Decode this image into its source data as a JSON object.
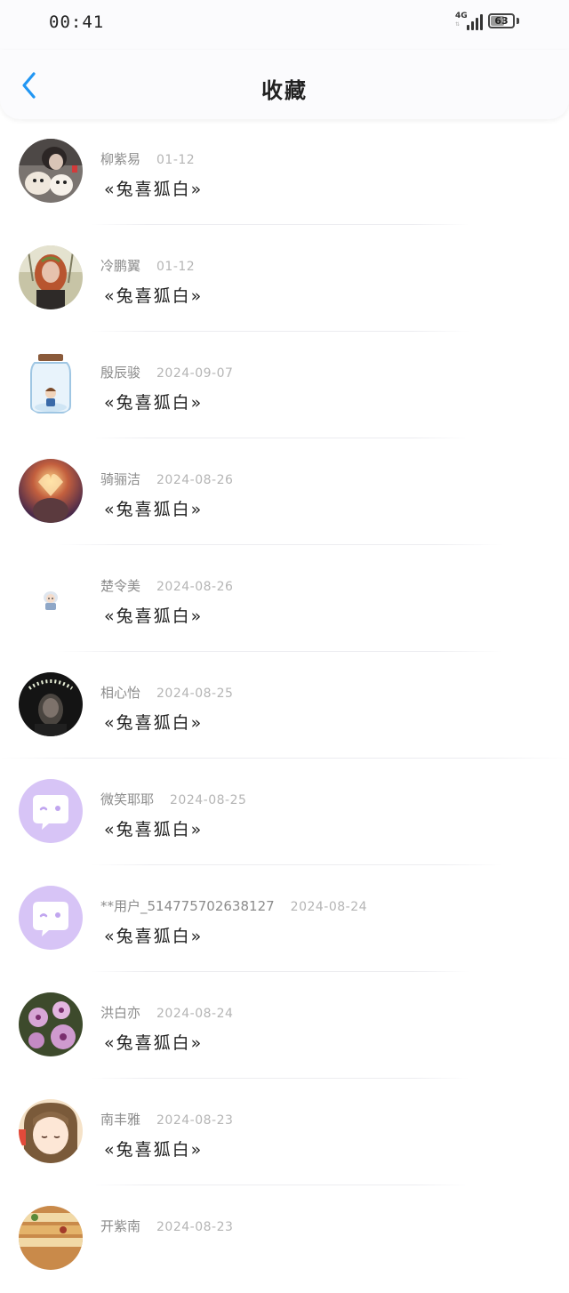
{
  "status_bar": {
    "time": "00:41",
    "network": "4G",
    "battery": "63",
    "battery_level": 0.63
  },
  "header": {
    "title": "收藏"
  },
  "items": [
    {
      "name": "柳紫易",
      "date": "01-12",
      "title": "«兔喜狐白»",
      "avatar": "photo-girl-with-dogs"
    },
    {
      "name": "冷鹏翼",
      "date": "01-12",
      "title": "«兔喜狐白»",
      "avatar": "photo-red-hair-girl"
    },
    {
      "name": "殷辰骏",
      "date": "2024-09-07",
      "title": "«兔喜狐白»",
      "avatar": "jar-illustration"
    },
    {
      "name": "骑骊洁",
      "date": "2024-08-26",
      "title": "«兔喜狐白»",
      "avatar": "photo-heart-hands"
    },
    {
      "name": "楚令美",
      "date": "2024-08-26",
      "title": "«兔喜狐白»",
      "avatar": "small-cartoon"
    },
    {
      "name": "相心怡",
      "date": "2024-08-25",
      "title": "«兔喜狐白»",
      "avatar": "photo-flower-crown"
    },
    {
      "name": "微笑耶耶",
      "date": "2024-08-25",
      "title": "«兔喜狐白»",
      "avatar": "default-chat-avatar"
    },
    {
      "name": "**用户_514775702638127",
      "date": "2024-08-24",
      "title": "«兔喜狐白»",
      "avatar": "default-chat-avatar"
    },
    {
      "name": "洪白亦",
      "date": "2024-08-24",
      "title": "«兔喜狐白»",
      "avatar": "photo-orchids"
    },
    {
      "name": "南丰雅",
      "date": "2024-08-23",
      "title": "«兔喜狐白»",
      "avatar": "anime-girl"
    },
    {
      "name": "开紫南",
      "date": "2024-08-23",
      "title": "",
      "avatar": "photo-food"
    }
  ]
}
